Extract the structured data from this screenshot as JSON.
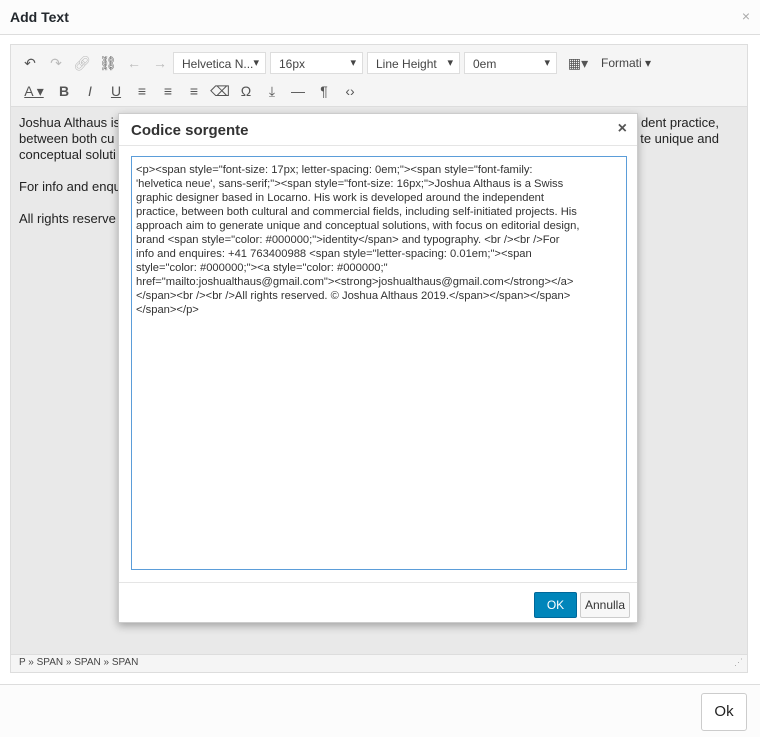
{
  "dialog": {
    "title": "Add Text",
    "close": "×",
    "ok_label": "Ok"
  },
  "toolbar": {
    "font_family": "Helvetica N...",
    "font_size": "16px",
    "line_height": "Line Height",
    "letter_spacing": "0em",
    "formats": "Formati"
  },
  "content": {
    "lines": [
      "Joshua Althaus is",
      "between both cu",
      "conceptual soluti",
      "",
      "For info and enqu",
      "",
      "All rights reserve"
    ],
    "right_lines": [
      "dent practice,",
      "te unique and"
    ]
  },
  "statusbar": {
    "path": "P » SPAN » SPAN » SPAN"
  },
  "source_modal": {
    "title": "Codice sorgente",
    "close": "×",
    "ok_label": "OK",
    "cancel_label": "Annulla",
    "code_lines": [
      "<p><span style=\"font-size: 17px; letter-spacing: 0em;\"><span style=\"font-family:",
      "'helvetica neue', sans-serif;\"><span style=\"font-size: 16px;\">Joshua Althaus is a Swiss",
      "graphic designer based in Locarno. His work is developed around the independent",
      "practice, between both cultural and commercial fields, including self-initiated projects. His",
      "approach aim to generate unique and conceptual solutions, with focus on editorial design,",
      "brand <span style=\"color: #000000;\">identity</span> and typography. <br /><br />For",
      "info and enquires: +41 763400988  <span style=\"letter-spacing: 0.01em;\"><span",
      "style=\"color: #000000;\"><a style=\"color: #000000;\"",
      "href=\"mailto:joshualthaus@gmail.com\"><strong>joshualthaus@gmail.com</strong></a>",
      "</span><br /><br />All rights reserved. © Joshua Althaus 2019.</span></span></span>",
      "</span></p>"
    ]
  },
  "colors": {
    "accent": "#0085ba",
    "focus_border": "#5b9dd9"
  }
}
